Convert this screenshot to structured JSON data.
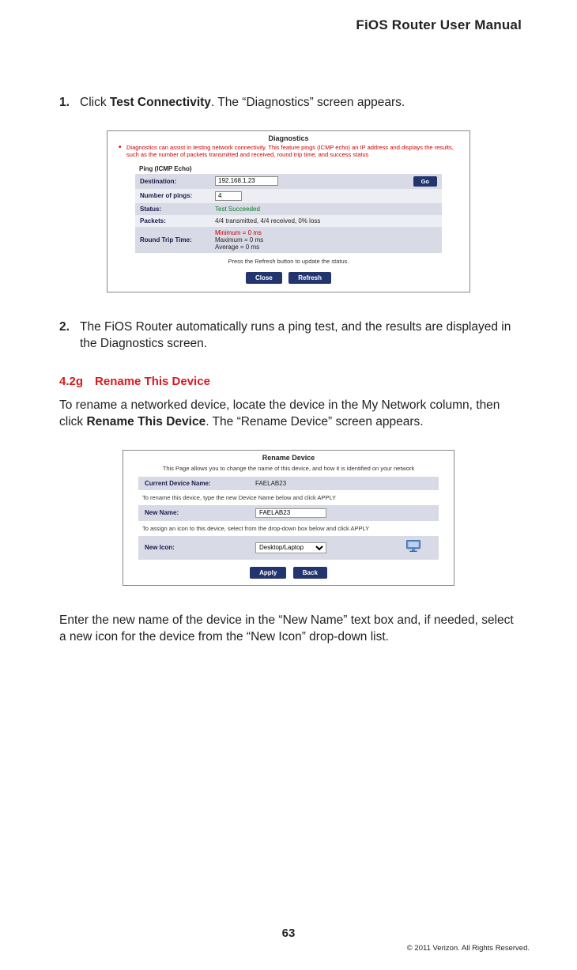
{
  "header": {
    "title": "FiOS Router User Manual"
  },
  "step1": {
    "num": "1.",
    "pre": "Click ",
    "bold": "Test Connectivity",
    "post": ". The “Diagnostics” screen appears."
  },
  "diag": {
    "title": "Diagnostics",
    "note": "Diagnostics can assist in testing network connectivity. This feature pings (ICMP echo) an IP address and displays the results, such as the number of packets transmitted and received, round trip time, and success status",
    "ping_head": "Ping (ICMP Echo)",
    "rows": {
      "dest_lbl": "Destination:",
      "dest_val": "192.168.1.23",
      "go": "Go",
      "num_lbl": "Number of pings:",
      "num_val": "4",
      "status_lbl": "Status:",
      "status_val": "Test Succeeded",
      "pkts_lbl": "Packets:",
      "pkts_val": "4/4 transmitted, 4/4 received, 0% loss",
      "rtt_lbl": "Round Trip Time:",
      "rtt_min": "Minimum = 0 ms",
      "rtt_max": "Maximum = 0 ms",
      "rtt_avg": "Average = 0 ms"
    },
    "press": "Press the Refresh button to update the status.",
    "close": "Close",
    "refresh": "Refresh"
  },
  "step2": {
    "num": "2.",
    "text": "The FiOS Router automatically runs a ping test, and the results are displayed in the Diagnostics screen."
  },
  "section": {
    "head": "4.2g Rename This Device"
  },
  "rename_intro": {
    "pre": "To rename a networked device, locate the device in the My Network column, then click ",
    "bold": "Rename This Device",
    "post": ". The “Rename Device” screen appears."
  },
  "rename": {
    "title": "Rename Device",
    "help": "This Page allows you to change the name of this device, and how it is identified on your network",
    "cur_lbl": "Current Device Name:",
    "cur_val": "FAELAB23",
    "inst1": "To rename this device, type the new Device Name below and click APPLY",
    "new_lbl": "New Name:",
    "new_val": "FAELAB23",
    "inst2": "To assign an icon to this device, select from the drop-down box below and click APPLY",
    "icon_lbl": "New Icon:",
    "icon_val": "Desktop/Laptop",
    "apply": "Apply",
    "back": "Back"
  },
  "outro": "Enter the new name of the device in the “New Name” text box and, if needed, select a new icon for the device from the “New Icon” drop-down list.",
  "page_num": "63",
  "copyright": "© 2011 Verizon. All Rights Reserved."
}
